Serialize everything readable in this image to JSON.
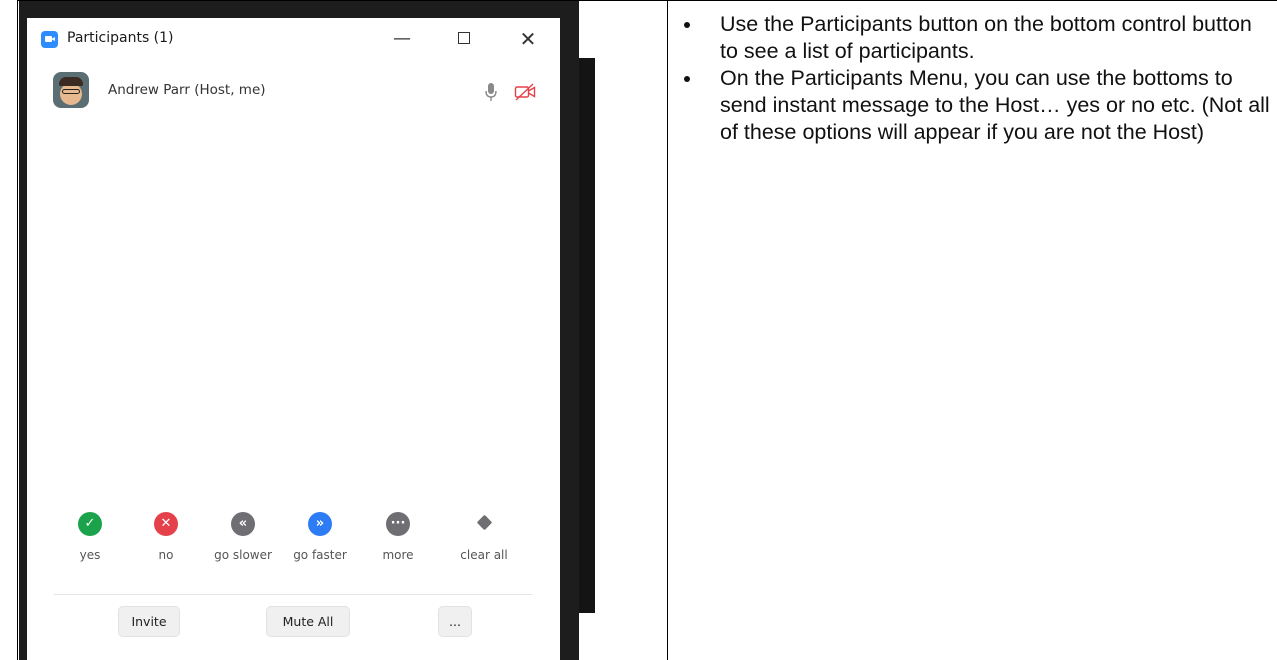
{
  "window": {
    "title": "Participants (1)",
    "minimize_glyph": "—",
    "close_glyph": "✕"
  },
  "participant": {
    "name": "Andrew Parr (Host, me)",
    "mic_icon": "microphone-icon",
    "video_icon": "video-off-icon"
  },
  "reactions": [
    {
      "label": "yes",
      "glyph": "✓",
      "color": "#1aa34a"
    },
    {
      "label": "no",
      "glyph": "✕",
      "color": "#e5414a"
    },
    {
      "label": "go slower",
      "glyph": "«",
      "color": "#6e6e73"
    },
    {
      "label": "go faster",
      "glyph": "»",
      "color": "#2d7cf6"
    },
    {
      "label": "more",
      "glyph": "···",
      "color": "#6e6e73"
    },
    {
      "label": "clear all"
    }
  ],
  "footer": {
    "invite": "Invite",
    "mute_all": "Mute All",
    "more": "..."
  },
  "notes": [
    "Use the Participants button on the bottom control button to see a list of participants.",
    "On the Participants Menu, you can use the bottoms to send instant message to the Host… yes or no etc. (Not all of these options will appear if you are not the Host)"
  ]
}
